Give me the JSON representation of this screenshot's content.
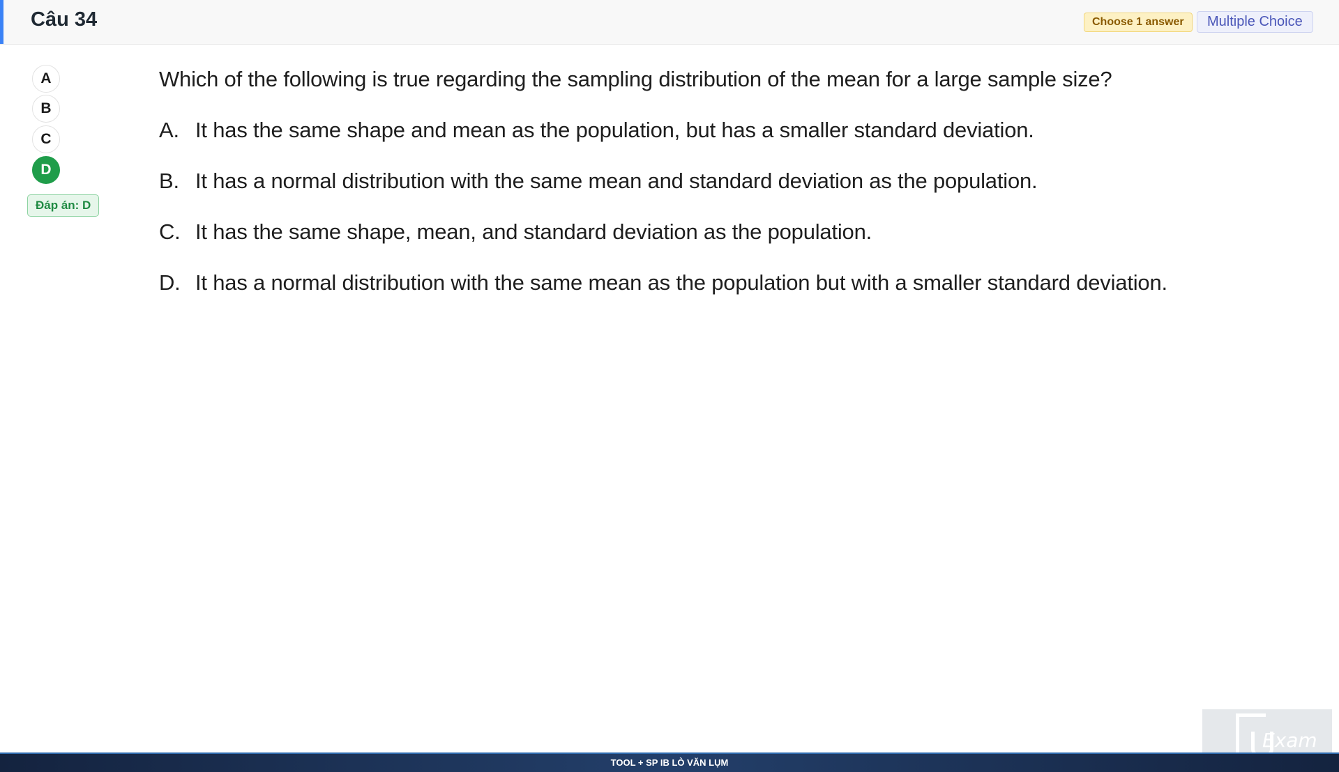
{
  "header": {
    "title": "Câu 34",
    "choose_badge": "Choose 1 answer",
    "type_badge": "Multiple Choice"
  },
  "answer_selector": {
    "options": [
      "A",
      "B",
      "C",
      "D"
    ],
    "selected": "D",
    "answer_label": "Đáp án: D"
  },
  "question": {
    "stem": "Which of the following is true regarding the sampling distribution of the mean for a large sample size?",
    "options": [
      {
        "letter": "A.",
        "text": "It has the same shape and mean as the population, but has a smaller standard deviation."
      },
      {
        "letter": "B.",
        "text": "It has a normal distribution with the same mean and standard deviation as the population."
      },
      {
        "letter": "C.",
        "text": "It has the same shape, mean, and standard deviation as the population."
      },
      {
        "letter": "D.",
        "text": "It has a normal distribution with the same mean as the population but with a smaller standard deviation."
      }
    ]
  },
  "footer": {
    "text": "TOOL + SP IB LÒ VĂN LỤM"
  },
  "watermark": {
    "logo_text": "Exam"
  },
  "colors": {
    "accent": "#3b82f6",
    "selected_answer": "#1f9d4a",
    "footer_bg": "#1b2f52"
  }
}
